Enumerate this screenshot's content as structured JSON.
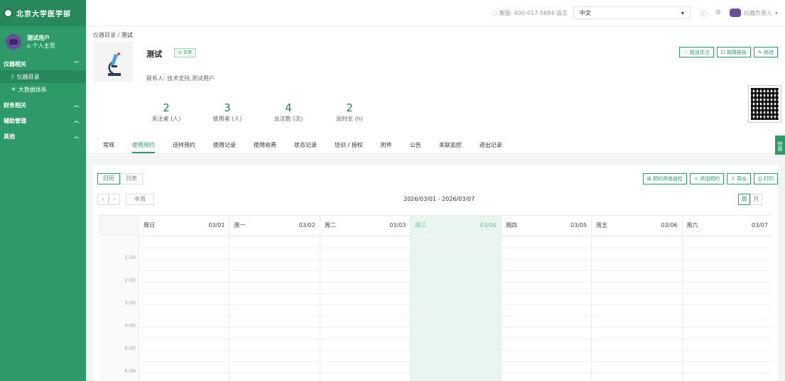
{
  "brand": {
    "logo_text": "北京大学医学部"
  },
  "sidebar": {
    "user_name": "测试用户",
    "user_home": "个人主页",
    "groups": [
      {
        "label": "仪器相关",
        "items": [
          {
            "label": "仪器目录"
          },
          {
            "label": "大数据体系"
          }
        ]
      },
      {
        "label": "财务相关"
      },
      {
        "label": "辅助管理"
      },
      {
        "label": "其他"
      }
    ]
  },
  "topbar": {
    "service": "客服: 400-017-5684 语言",
    "language": "中文",
    "operator": "仪器负责人"
  },
  "breadcrumb": {
    "root": "仪器目录",
    "current": "测试"
  },
  "instrument": {
    "title": "测试",
    "status": "正常",
    "contact": "联系人: 技术支持,测试用户"
  },
  "actions": {
    "unfollow": "取消关注",
    "fault": "故障报告",
    "edit": "修改"
  },
  "stats": [
    {
      "value": "2",
      "label": "关注者 (人)"
    },
    {
      "value": "3",
      "label": "使用者 (人)"
    },
    {
      "value": "4",
      "label": "总次数 (次)"
    },
    {
      "value": "2",
      "label": "总时长 (h)"
    }
  ],
  "tabs": [
    "常规",
    "使用预约",
    "送样预约",
    "使用记录",
    "使用收费",
    "状态记录",
    "培训 / 授权",
    "附件",
    "公告",
    "关联监控",
    "进出记录"
  ],
  "side_tag": "快链",
  "calendar": {
    "seg": [
      "日历",
      "列表"
    ],
    "tools": [
      "预约资格自检",
      "添加预约",
      "导出",
      "打印"
    ],
    "this_week": "本周",
    "range": "2026/03/01 - 2026/03/07",
    "views": [
      "周",
      "月"
    ],
    "days": [
      {
        "name": "周日",
        "date": "03/01"
      },
      {
        "name": "周一",
        "date": "03/02"
      },
      {
        "name": "周二",
        "date": "03/03"
      },
      {
        "name": "周三",
        "date": "03/04"
      },
      {
        "name": "周四",
        "date": "03/05"
      },
      {
        "name": "周五",
        "date": "03/06"
      },
      {
        "name": "周六",
        "date": "03/07"
      }
    ],
    "times": [
      "1:00",
      "2:00",
      "3:00",
      "4:00",
      "5:00",
      "6:00"
    ]
  }
}
